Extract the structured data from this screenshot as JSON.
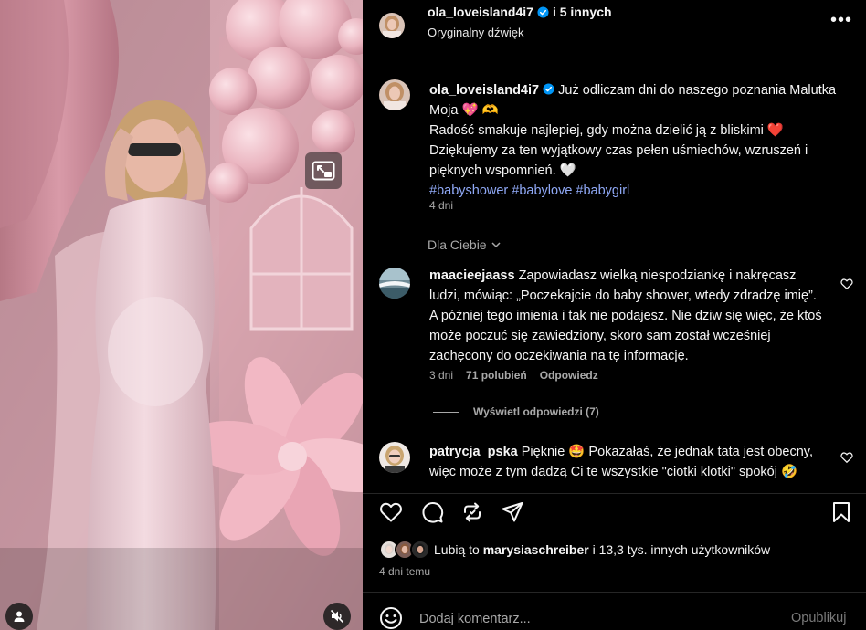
{
  "colors": {
    "background": "#000000",
    "text_primary": "#f5f5f5",
    "text_secondary": "#a8a8a8",
    "hashtag": "#8fa8f5",
    "verified_badge": "#0095f6",
    "divider": "#262626"
  },
  "media": {
    "pip_icon": "picture-in-picture-icon",
    "user_tag_icon": "person-icon",
    "mute_icon": "speaker-muted-icon"
  },
  "header": {
    "username": "ola_loveisland4i7",
    "coauthors": "i 5 innych",
    "audio": "Oryginalny dźwięk",
    "more_icon": "more-horizontal-icon",
    "more_label": "•••"
  },
  "caption": {
    "username": "ola_loveisland4i7",
    "line1": "Już odliczam dni do naszego poznania Malutka Moja",
    "emoji1": "💖",
    "emoji2": "🫶",
    "line2": "Radość smakuje najlepiej, gdy można dzielić ją z bliskimi",
    "emoji3": "❤️",
    "line3": "Dziękujemy za ten wyjątkowy czas pełen uśmiechów, wzruszeń i pięknych wspomnień.",
    "emoji4": "🤍",
    "hashtags": [
      "#babyshower",
      "#babylove",
      "#babygirl"
    ],
    "time": "4 dni"
  },
  "filter": {
    "label": "Dla Ciebie",
    "icon": "chevron-down-icon"
  },
  "comments": [
    {
      "username": "maacieejaass",
      "text": "Zapowiadasz wielką niespodziankę i nakręcasz ludzi, mówiąc: „Poczekajcie do baby shower, wtedy zdradzę imię”. A później tego imienia i tak nie podajesz. Nie dziw się więc, że ktoś może poczuć się zawiedziony, skoro sam został wcześniej zachęcony do oczekiwania na tę informację.",
      "time": "3 dni",
      "likes": "71 polubień",
      "reply": "Odpowiedz",
      "view_replies": "Wyświetl odpowiedzi (7)"
    },
    {
      "username": "patrycja_pska",
      "text": "Pięknie 🤩 Pokazałaś, że jednak tata jest obecny, więc może z tym dadzą Ci te wszystkie \"ciotki klotki\" spokój 🤣"
    }
  ],
  "actions": {
    "like_icon": "heart-icon",
    "comment_icon": "comment-icon",
    "share_icon": "repost-icon",
    "send_icon": "send-icon",
    "save_icon": "bookmark-icon"
  },
  "likes": {
    "prefix": "Lubią to",
    "user": "marysiaschreiber",
    "suffix": "i 13,3 tys. innych użytkowników"
  },
  "post_date": "4 dni temu",
  "comment_bar": {
    "emoji_icon": "emoji-icon",
    "placeholder": "Dodaj komentarz...",
    "publish": "Opublikuj"
  }
}
